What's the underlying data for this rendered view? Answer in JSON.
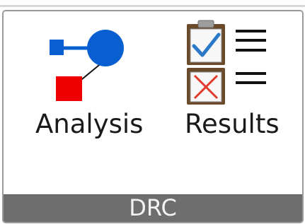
{
  "ribbon": {
    "group": {
      "title": "DRC",
      "commands": [
        {
          "label": "Analysis",
          "icon": "network-nodes-icon"
        },
        {
          "label": "Results",
          "icon": "checklist-results-icon"
        }
      ]
    }
  },
  "colors": {
    "node_blue": "#0a5fd0",
    "node_red": "#ee0000",
    "footer_gray": "#6e6e6e"
  }
}
